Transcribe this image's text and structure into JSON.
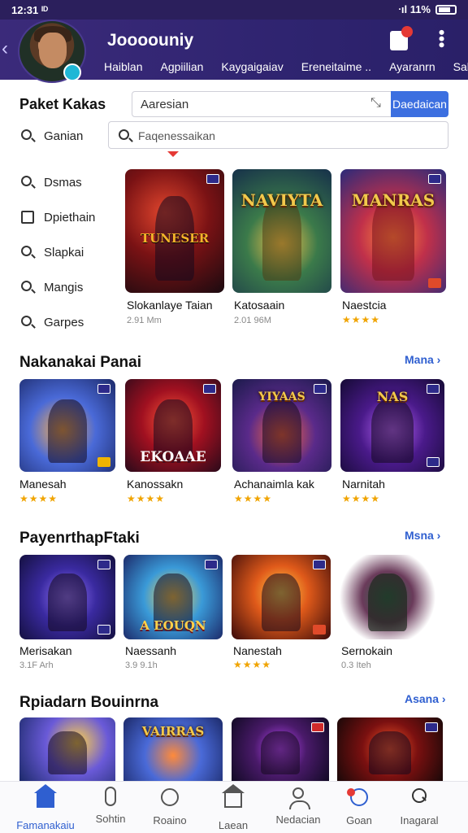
{
  "status": {
    "time": "12:31 ᴵᴰ",
    "signal": "ᐧıl 11%"
  },
  "header": {
    "title": "Joooouniy",
    "tabs": [
      "Haiblan",
      "Agpiilian",
      "Kaygaigaiav",
      "Ereneitaime ..",
      "Ayaranrn",
      "Sah"
    ]
  },
  "search": {
    "label": "Paket Kakas",
    "placeholder": "Aaresian",
    "button": "Daedaican"
  },
  "filter": {
    "placeholder": "Faqenessaikan"
  },
  "categories": [
    {
      "label": "Ganian",
      "icon": "search-icon"
    },
    {
      "label": "Dsmas",
      "icon": "search-icon"
    },
    {
      "label": "Dpiethain",
      "icon": "grid-icon"
    },
    {
      "label": "Slapkai",
      "icon": "search-icon"
    },
    {
      "label": "Mangis",
      "icon": "search-icon"
    },
    {
      "label": "Garpes",
      "icon": "search-icon"
    }
  ],
  "featured": [
    {
      "name": "Slokanlaye Taian",
      "sub": "2.91 Mm",
      "logo": "TUNESER"
    },
    {
      "name": "Katosaain",
      "sub": "2.01 96M",
      "logo": "NAVIYTA"
    },
    {
      "name": "Naestcia",
      "rating": "★★★★",
      "logo": "MANRAS"
    }
  ],
  "sections": [
    {
      "title": "Nakanakai Panai",
      "more": "Mana ›",
      "items": [
        {
          "name": "Manesah",
          "rating": "★★★★"
        },
        {
          "name": "Kanossakn",
          "rating": "★★★★",
          "logo": "EKOAAE"
        },
        {
          "name": "Achanaimla kak",
          "rating": "★★★★",
          "logo": "YIYAAS"
        },
        {
          "name": "Narnitah",
          "rating": "★★★★",
          "logo": "NAS"
        }
      ]
    },
    {
      "title": "PayenrthapFtaki",
      "more": "Msna ›",
      "items": [
        {
          "name": "Merisakan",
          "sub": "3.1F Arh"
        },
        {
          "name": "Naessanh",
          "sub": "3.9 9.1h",
          "logo": "A EOUQN"
        },
        {
          "name": "Nanestah",
          "rating": "★★★★"
        },
        {
          "name": "Sernokain",
          "sub": "0.3 Iteh"
        }
      ]
    },
    {
      "title": "Rpiadarn Bouinrna",
      "more": "Asana ›",
      "items": [
        {
          "name": ""
        },
        {
          "name": "",
          "logo": "VAIRRAS"
        },
        {
          "name": ""
        },
        {
          "name": ""
        }
      ]
    }
  ],
  "nav": [
    {
      "label": "Famanakaiu",
      "icon": "home-icon",
      "active": true
    },
    {
      "label": "Sohtin",
      "icon": "pill-icon"
    },
    {
      "label": "Roaino",
      "icon": "circle-icon"
    },
    {
      "label": "Laean",
      "icon": "home-outline-icon"
    },
    {
      "label": "Nedacian",
      "icon": "person-icon"
    },
    {
      "label": "Goan",
      "icon": "game-icon"
    },
    {
      "label": "Inagaral",
      "icon": "search-icon"
    }
  ],
  "colors": {
    "header": "#2f2470",
    "accent": "#3c6fe0",
    "star": "#f0a400"
  }
}
